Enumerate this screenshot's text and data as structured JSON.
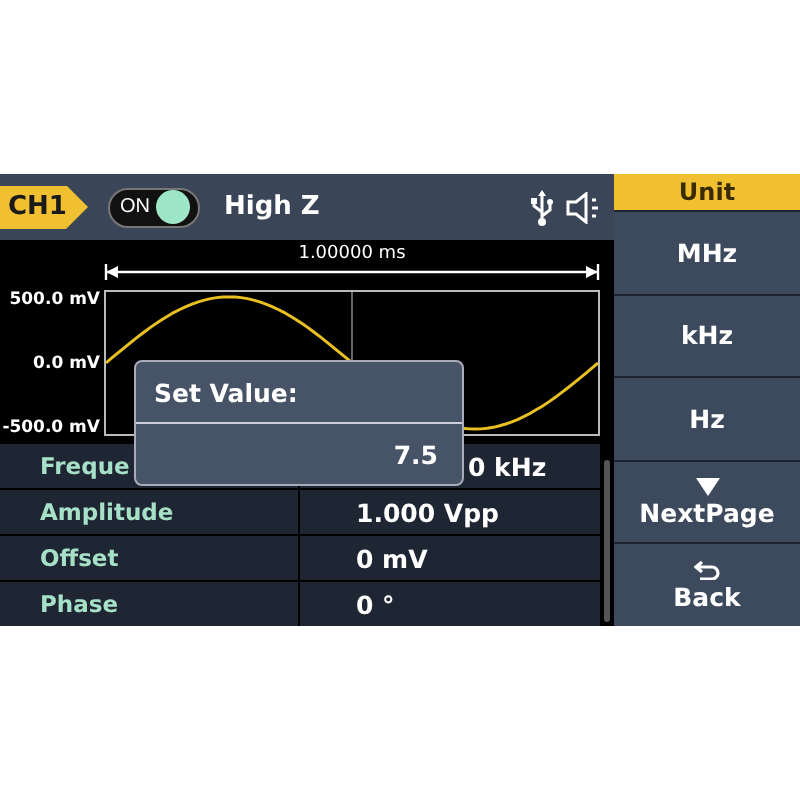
{
  "channel": {
    "label": "CH1"
  },
  "output": {
    "label": "ON",
    "on": true
  },
  "load": "High Z",
  "waveform": {
    "time_span": "1.00000 ms",
    "y_labels": [
      "500.0 mV",
      "0.0 mV",
      "-500.0 mV"
    ]
  },
  "parameters": [
    {
      "label": "Freque",
      "value": "0 kHz",
      "covered": true
    },
    {
      "label": "Amplitude",
      "value": "1.000 Vpp",
      "covered": false
    },
    {
      "label": "Offset",
      "value": "0 mV",
      "covered": false
    },
    {
      "label": "Phase",
      "value": "0 °",
      "covered": false
    }
  ],
  "dialog": {
    "title": "Set Value:",
    "value": "7.5"
  },
  "softkeys": {
    "title": "Unit",
    "items": [
      {
        "label": "MHz",
        "kind": "plain"
      },
      {
        "label": "kHz",
        "kind": "plain"
      },
      {
        "label": "Hz",
        "kind": "plain"
      },
      {
        "label": "NextPage",
        "kind": "down"
      },
      {
        "label": "Back",
        "kind": "back"
      }
    ]
  }
}
